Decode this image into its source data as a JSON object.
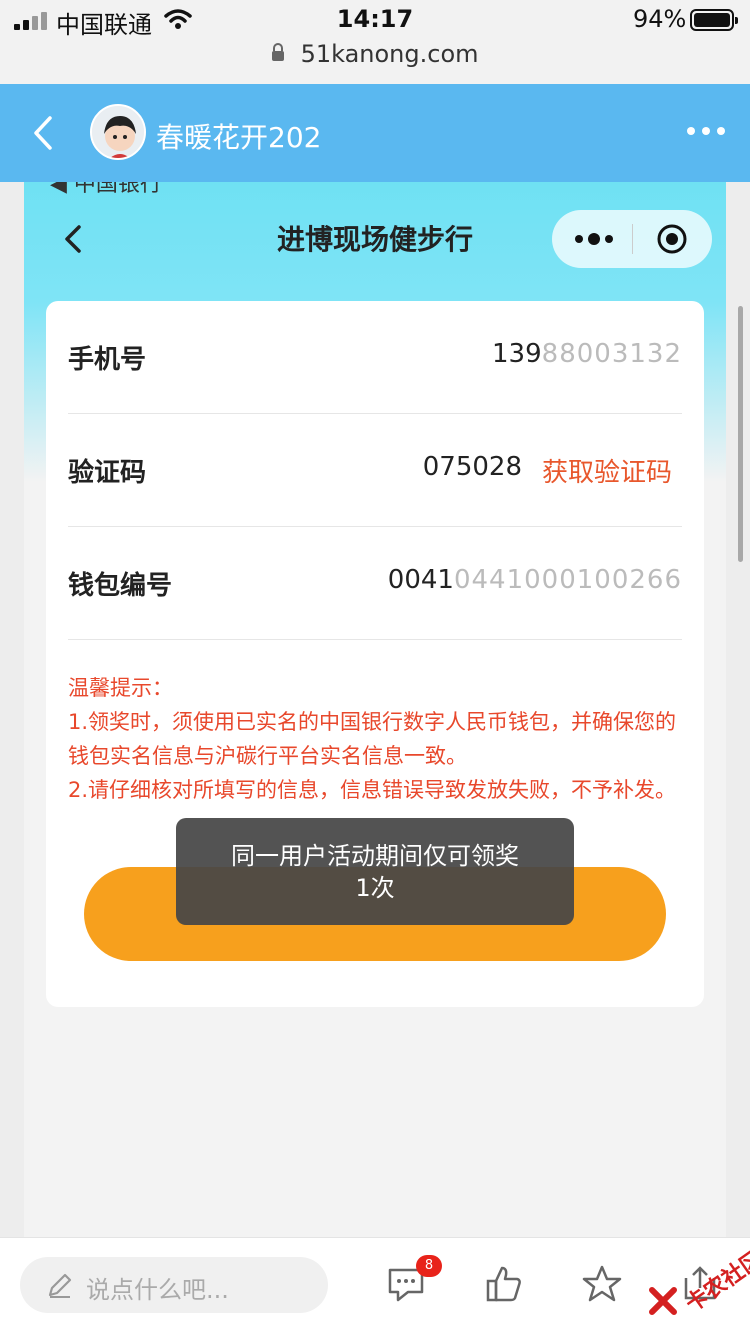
{
  "status_bar": {
    "carrier": "中国联通",
    "time": "14:17",
    "battery_percent": "94%"
  },
  "browser": {
    "url": "51kanong.com"
  },
  "app_header": {
    "username": "春暖花开202"
  },
  "embedded_page": {
    "cutoff_text": "◀ 中国银行",
    "title": "进博现场健步行",
    "form": {
      "phone": {
        "label": "手机号",
        "value": "139",
        "masked_tail": "88003132"
      },
      "code": {
        "label": "验证码",
        "value": "075028",
        "action": "获取验证码"
      },
      "wallet": {
        "label": "钱包编号",
        "value": "0041",
        "masked_tail": "0441000100266"
      }
    },
    "tips": {
      "title": "温馨提示：",
      "line1": "1.领奖时，须使用已实名的中国银行数字人民币钱包，并确保您的钱包实名信息与沪碳行平台实名信息一致。",
      "line2": "2.请仔细核对所填写的信息，信息错误导致发放失败，不予补发。"
    },
    "toast": {
      "line1": "同一用户活动期间仅可领奖",
      "line2": "1次"
    }
  },
  "bottom_bar": {
    "comment_placeholder": "说点什么吧...",
    "message_badge": "8",
    "watermark": "卡农社区"
  },
  "colors": {
    "header_blue": "#5ab8f0",
    "accent_orange": "#f7a01d",
    "tip_red": "#e8482c",
    "action_red": "#e8572c"
  }
}
